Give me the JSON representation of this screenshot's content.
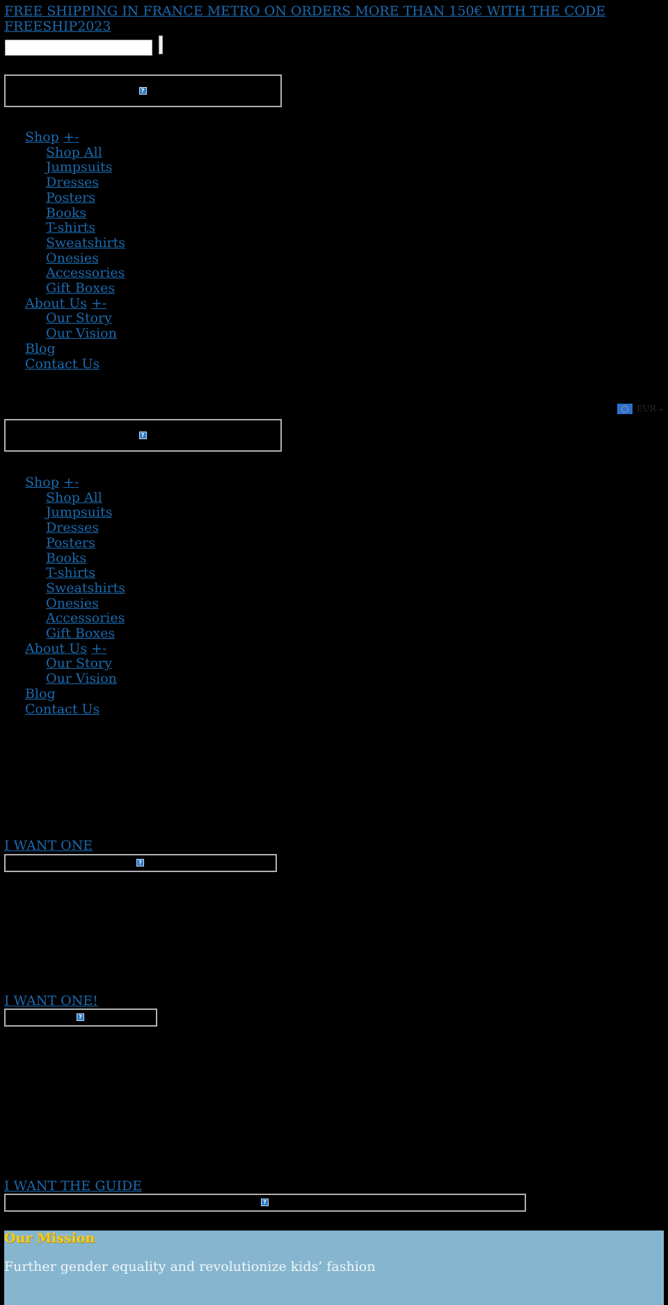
{
  "announcement": {
    "text": "FREE SHIPPING IN FRANCE METRO ON ORDERS MORE THAN 150€ WITH THE CODE FREESHIP2023"
  },
  "search": {
    "value": "",
    "placeholder": "",
    "button_label": ""
  },
  "logo": {
    "alt": "?"
  },
  "menus": [
    {
      "items": [
        {
          "label": "Shop",
          "toggle": "+-",
          "children": [
            "Shop All",
            "Jumpsuits",
            "Dresses",
            "Posters",
            "Books",
            "T-shirts",
            "Sweatshirts",
            "Onesies",
            "Accessories",
            "Gift Boxes"
          ]
        },
        {
          "label": "About Us",
          "toggle": "+-",
          "children": [
            "Our Story",
            "Our Vision"
          ]
        },
        {
          "label": "Blog",
          "children": []
        },
        {
          "label": "Contact Us",
          "children": []
        }
      ]
    },
    {
      "items": [
        {
          "label": "Shop",
          "toggle": "+-",
          "children": [
            "Shop All",
            "Jumpsuits",
            "Dresses",
            "Posters",
            "Books",
            "T-shirts",
            "Sweatshirts",
            "Onesies",
            "Accessories",
            "Gift Boxes"
          ]
        },
        {
          "label": "About Us",
          "toggle": "+-",
          "children": [
            "Our Story",
            "Our Vision"
          ]
        },
        {
          "label": "Blog",
          "children": []
        },
        {
          "label": "Contact Us",
          "children": []
        }
      ]
    }
  ],
  "currency": {
    "code": "EUR",
    "flag_icon": "eu-flag-icon",
    "chevron_icon": "chevron-down-icon"
  },
  "ctas": [
    {
      "label": "I WANT ONE"
    },
    {
      "label": "I WANT ONE!"
    },
    {
      "label": "I WANT THE GUIDE"
    }
  ],
  "broken_image_glyph": "?",
  "mission": {
    "title": "Our Mission",
    "text": "Further gender equality and revolutionize kids’ fashion"
  },
  "colors": {
    "background": "#000000",
    "link": "#1b6ab0",
    "mission_bg": "#86b6cf",
    "mission_title": "#f5cc1c",
    "mission_text": "#f3f6f8"
  }
}
